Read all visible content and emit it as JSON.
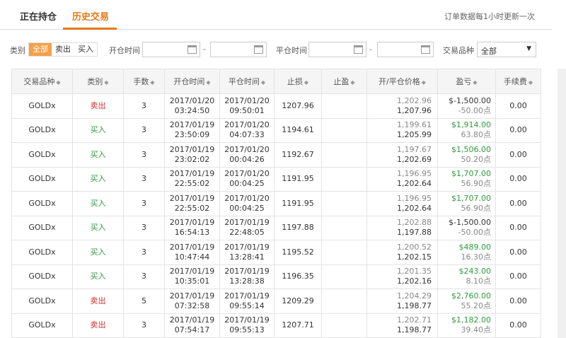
{
  "tabs": {
    "active": "正在持仓",
    "history": "历史交易"
  },
  "notice": "订单数据每1小时更新一次",
  "filters": {
    "type_label": "类别",
    "type_options": [
      "全部",
      "卖出",
      "买入"
    ],
    "open_time_label": "开仓时间",
    "close_time_label": "平仓时间",
    "dash": "-",
    "product_label": "交易品种",
    "product_value": "全部"
  },
  "table": {
    "headers": [
      "交易品种",
      "类别",
      "手数",
      "开仓时间",
      "平仓时间",
      "止损",
      "止盈",
      "开/平仓价格",
      "盈亏",
      "手续费"
    ],
    "rows": [
      {
        "product": "GOLDx",
        "type": "卖出",
        "kind": "sell",
        "lots": "3",
        "open_date": "2017/01/20",
        "open_time": "03:24:50",
        "close_date": "2017/01/20",
        "close_time": "09:50:01",
        "sl": "1207.96",
        "tp": "",
        "open_price": "1,202.96",
        "close_price": "1,207.96",
        "pl": "$-1,500.00",
        "pl_sign": "neg",
        "pts": "-50.00点",
        "fee": "0.00"
      },
      {
        "product": "GOLDx",
        "type": "买入",
        "kind": "buy",
        "lots": "3",
        "open_date": "2017/01/19",
        "open_time": "23:50:09",
        "close_date": "2017/01/20",
        "close_time": "04:07:33",
        "sl": "1194.61",
        "tp": "",
        "open_price": "1,199.61",
        "close_price": "1,205.99",
        "pl": "$1,914.00",
        "pl_sign": "pos",
        "pts": "63.80点",
        "fee": "0.00"
      },
      {
        "product": "GOLDx",
        "type": "买入",
        "kind": "buy",
        "lots": "3",
        "open_date": "2017/01/19",
        "open_time": "23:02:02",
        "close_date": "2017/01/20",
        "close_time": "00:04:26",
        "sl": "1192.67",
        "tp": "",
        "open_price": "1,197.67",
        "close_price": "1,202.69",
        "pl": "$1,506.00",
        "pl_sign": "pos",
        "pts": "50.20点",
        "fee": "0.00"
      },
      {
        "product": "GOLDx",
        "type": "买入",
        "kind": "buy",
        "lots": "3",
        "open_date": "2017/01/19",
        "open_time": "22:55:02",
        "close_date": "2017/01/20",
        "close_time": "00:04:25",
        "sl": "1191.95",
        "tp": "",
        "open_price": "1,196.95",
        "close_price": "1,202.64",
        "pl": "$1,707.00",
        "pl_sign": "pos",
        "pts": "56.90点",
        "fee": "0.00"
      },
      {
        "product": "GOLDx",
        "type": "买入",
        "kind": "buy",
        "lots": "3",
        "open_date": "2017/01/19",
        "open_time": "22:55:02",
        "close_date": "2017/01/20",
        "close_time": "00:04:25",
        "sl": "1191.95",
        "tp": "",
        "open_price": "1,196.95",
        "close_price": "1,202.64",
        "pl": "$1,707.00",
        "pl_sign": "pos",
        "pts": "56.90点",
        "fee": "0.00"
      },
      {
        "product": "GOLDx",
        "type": "买入",
        "kind": "buy",
        "lots": "3",
        "open_date": "2017/01/19",
        "open_time": "16:54:13",
        "close_date": "2017/01/19",
        "close_time": "22:48:05",
        "sl": "1197.88",
        "tp": "",
        "open_price": "1,202.88",
        "close_price": "1,197.88",
        "pl": "$-1,500.00",
        "pl_sign": "neg",
        "pts": "-50.00点",
        "fee": "0.00"
      },
      {
        "product": "GOLDx",
        "type": "买入",
        "kind": "buy",
        "lots": "3",
        "open_date": "2017/01/19",
        "open_time": "10:47:44",
        "close_date": "2017/01/19",
        "close_time": "13:28:41",
        "sl": "1195.52",
        "tp": "",
        "open_price": "1,200.52",
        "close_price": "1,202.15",
        "pl": "$489.00",
        "pl_sign": "pos",
        "pts": "16.30点",
        "fee": "0.00"
      },
      {
        "product": "GOLDx",
        "type": "买入",
        "kind": "buy",
        "lots": "3",
        "open_date": "2017/01/19",
        "open_time": "10:35:01",
        "close_date": "2017/01/19",
        "close_time": "13:28:38",
        "sl": "1196.35",
        "tp": "",
        "open_price": "1,201.35",
        "close_price": "1,202.16",
        "pl": "$243.00",
        "pl_sign": "pos",
        "pts": "8.10点",
        "fee": "0.00"
      },
      {
        "product": "GOLDx",
        "type": "卖出",
        "kind": "sell",
        "lots": "5",
        "open_date": "2017/01/19",
        "open_time": "07:32:58",
        "close_date": "2017/01/19",
        "close_time": "09:55:14",
        "sl": "1209.29",
        "tp": "",
        "open_price": "1,204.29",
        "close_price": "1,198.77",
        "pl": "$2,760.00",
        "pl_sign": "pos",
        "pts": "55.20点",
        "fee": "0.00"
      },
      {
        "product": "GOLDx",
        "type": "卖出",
        "kind": "sell",
        "lots": "3",
        "open_date": "2017/01/19",
        "open_time": "07:54:17",
        "close_date": "2017/01/19",
        "close_time": "09:55:13",
        "sl": "1207.71",
        "tp": "",
        "open_price": "1,202.71",
        "close_price": "1,198.77",
        "pl": "$1,182.00",
        "pl_sign": "pos",
        "pts": "39.40点",
        "fee": "0.00"
      }
    ]
  }
}
